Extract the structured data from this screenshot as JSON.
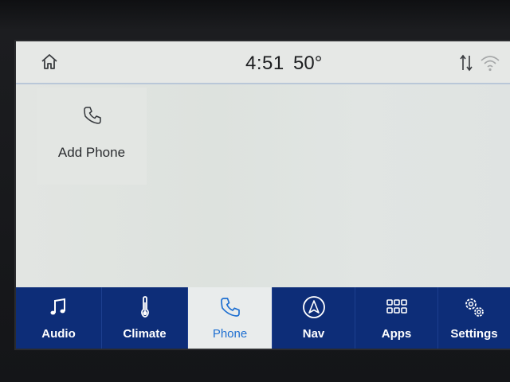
{
  "status_bar": {
    "time": "4:51",
    "temperature": "50°",
    "home_icon": "home-icon",
    "data_icon": "data-transfer-icon",
    "wifi_icon": "wifi-icon"
  },
  "content": {
    "tiles": [
      {
        "label": "Add Phone",
        "icon": "phone-icon"
      }
    ]
  },
  "nav": {
    "active": "Phone",
    "accent_color": "#1e6fd1",
    "bar_color": "#0d2d78",
    "items": [
      {
        "label": "Audio",
        "icon": "music-note-icon"
      },
      {
        "label": "Climate",
        "icon": "thermometer-icon"
      },
      {
        "label": "Phone",
        "icon": "phone-icon"
      },
      {
        "label": "Nav",
        "icon": "navigation-icon"
      },
      {
        "label": "Apps",
        "icon": "apps-grid-icon"
      },
      {
        "label": "Settings",
        "icon": "gears-icon"
      }
    ]
  }
}
